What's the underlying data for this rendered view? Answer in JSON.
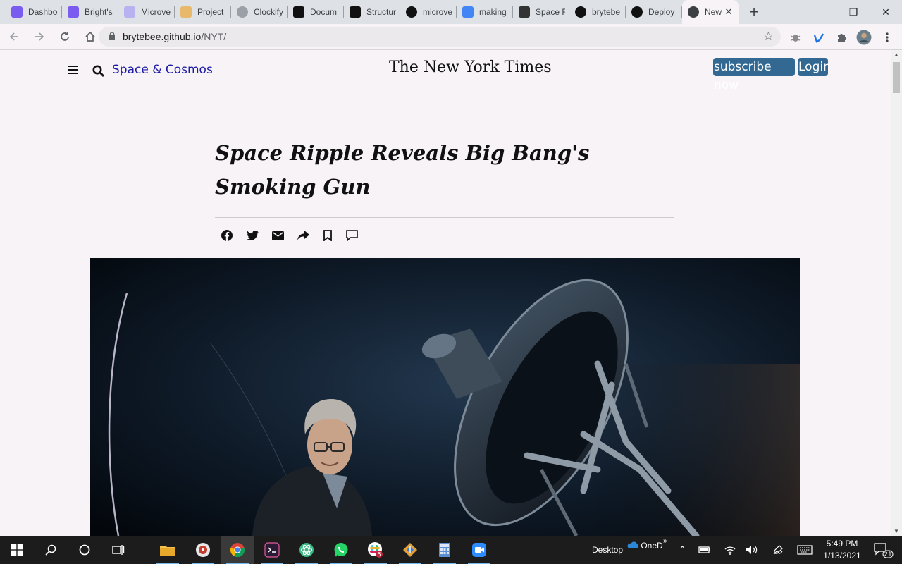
{
  "browser": {
    "tabs": [
      {
        "label": "Dashbo",
        "icon": "mural-icon",
        "color": "#7a5cf0"
      },
      {
        "label": "Bright's",
        "icon": "mural-icon",
        "color": "#7a5cf0"
      },
      {
        "label": "Microve",
        "icon": "mural-icon",
        "color": "#b8b2f0"
      },
      {
        "label": "Project",
        "icon": "project-icon",
        "color": "#e8b96a"
      },
      {
        "label": "Clockify",
        "icon": "clockify-icon",
        "color": "#9aa0a6"
      },
      {
        "label": "Docum",
        "icon": "notion-icon",
        "color": "#111111"
      },
      {
        "label": "Structur",
        "icon": "notion-icon",
        "color": "#111111"
      },
      {
        "label": "microve",
        "icon": "github-icon",
        "color": "#111111"
      },
      {
        "label": "making",
        "icon": "google-icon",
        "color": "#4285f4"
      },
      {
        "label": "Space F",
        "icon": "nyt-icon",
        "color": "#333333"
      },
      {
        "label": "brytebe",
        "icon": "github-icon",
        "color": "#111111"
      },
      {
        "label": "Deploy",
        "icon": "github-icon",
        "color": "#111111"
      },
      {
        "label": "New",
        "icon": "globe-icon",
        "color": "#3c4043",
        "active": true
      }
    ],
    "url_host": "brytebee.github.io",
    "url_path": "/NYT/"
  },
  "header": {
    "section": "Space & Cosmos",
    "masthead": "The New York Times",
    "subscribe": "subscribe now",
    "login": "Login",
    "button_color": "#326891"
  },
  "article": {
    "headline_line1": "Space Ripple Reveals Big Bang's",
    "headline_line2": "Smoking Gun"
  },
  "share_icons": [
    "facebook-icon",
    "twitter-icon",
    "email-icon",
    "share-icon",
    "bookmark-icon",
    "comment-icon"
  ],
  "taskbar": {
    "desktop_label": "Desktop",
    "onedrive_label": "OneD",
    "time": "5:49 PM",
    "date": "1/13/2021",
    "notifications": "21",
    "slack_badge": "5"
  }
}
